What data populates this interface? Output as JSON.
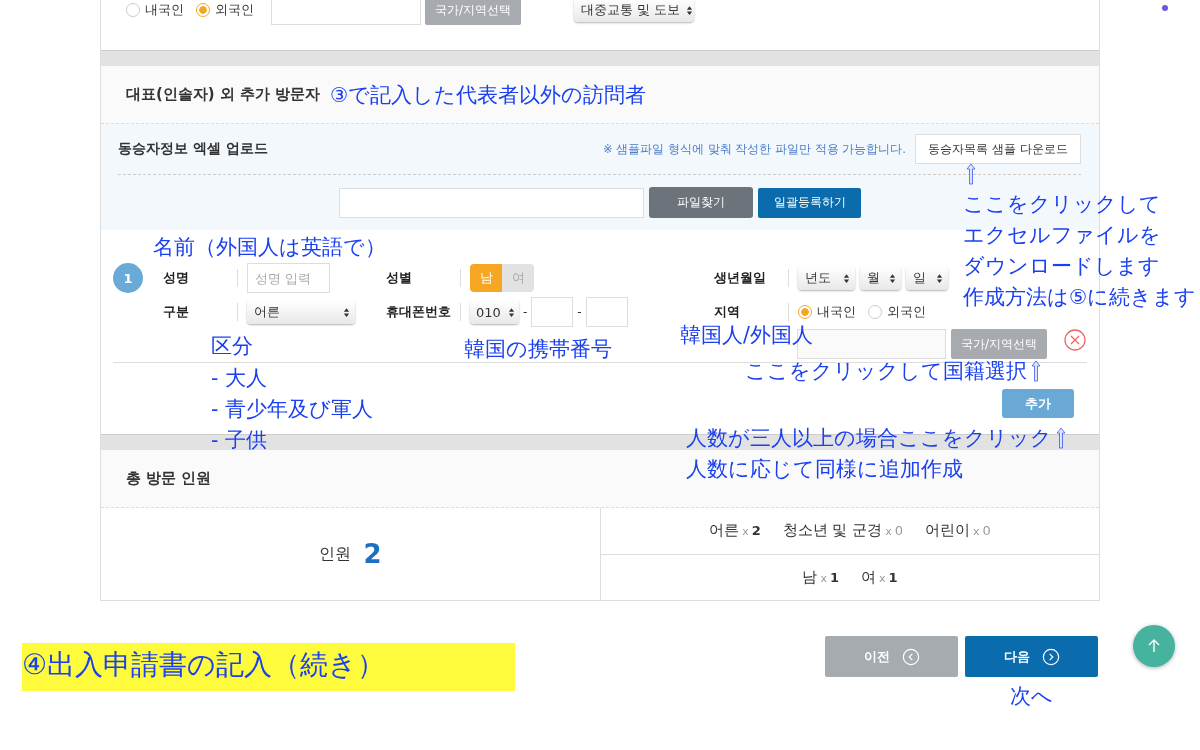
{
  "top_row": {
    "origin_options": [
      {
        "label": "내국인",
        "selected": false
      },
      {
        "label": "외국인",
        "selected": true
      }
    ],
    "country_button": "국가/지역선택",
    "transport_select": "대중교통 및 도보"
  },
  "section_title": "대표(인솔자) 외 추가 방문자",
  "upload": {
    "label": "동승자정보 엑셀 업로드",
    "note": "※ 샘플파일 형식에 맞춰 작성한 파일만 적용 가능합니다.",
    "sample_button": "동승자목록 샘플 다운로드",
    "browse_button": "파일찾기",
    "register_button": "일괄등록하기"
  },
  "visitors": [
    {
      "number": "1",
      "name_label": "성명",
      "name_placeholder": "성명 입력",
      "gender_label": "성별",
      "genders": [
        {
          "label": "남",
          "selected": true
        },
        {
          "label": "여",
          "selected": false
        }
      ],
      "birth_label": "생년월일",
      "birth_selects": [
        "년도",
        "월",
        "일"
      ],
      "type_label": "구분",
      "type_select": "어른",
      "phone_label": "휴대폰번호",
      "phone_prefix": "010",
      "phone_separators": [
        "-",
        "-"
      ],
      "region_label": "지역",
      "regions": [
        {
          "label": "내국인",
          "selected": true
        },
        {
          "label": "외국인",
          "selected": false
        }
      ],
      "country_button": "국가/지역선택"
    }
  ],
  "add_button": "추가",
  "total": {
    "title": "총 방문 인원",
    "label": "인원",
    "count": "2",
    "categories": [
      {
        "label": "어른",
        "sign": "x",
        "count": "2"
      },
      {
        "label": "청소년 및 군경",
        "sign": "x",
        "count": "0"
      },
      {
        "label": "어린이",
        "sign": "x",
        "count": "0"
      }
    ],
    "genders": [
      {
        "label": "남",
        "sign": "x",
        "count": "1"
      },
      {
        "label": "여",
        "sign": "x",
        "count": "1"
      }
    ]
  },
  "buttons": {
    "prev": "이전",
    "next": "다음"
  },
  "annotations": [
    {
      "kind": "note",
      "text": "③で記入した代表者以外の訪問者"
    },
    {
      "kind": "arrow"
    },
    {
      "kind": "note",
      "text": "ここをクリックして"
    },
    {
      "kind": "note",
      "text": "エクセルファイルを"
    },
    {
      "kind": "note",
      "text": "名前（外国人は英語で）"
    },
    {
      "kind": "note",
      "text": "ダウンロードします"
    },
    {
      "kind": "note",
      "text": "作成方法は⑤に続きます"
    },
    {
      "kind": "note",
      "text": "韓国人/外国人"
    },
    {
      "kind": "note",
      "text": "区分"
    },
    {
      "kind": "note",
      "text": "韓国の携帯番号"
    },
    {
      "kind": "note",
      "text": "- 大人"
    },
    {
      "kind": "note_arrow",
      "text": "ここをクリックして国籍選択"
    },
    {
      "kind": "note",
      "text": "- 青少年及び軍人"
    },
    {
      "kind": "note",
      "text": "- 子供"
    },
    {
      "kind": "note_arrow",
      "text": "人数が三人以上の場合ここをクリック"
    },
    {
      "kind": "note",
      "text": "人数に応じて同様に追加作成"
    },
    {
      "kind": "banner",
      "text": "④出入申請書の記入（続き）"
    },
    {
      "kind": "note",
      "text": "次へ"
    }
  ]
}
